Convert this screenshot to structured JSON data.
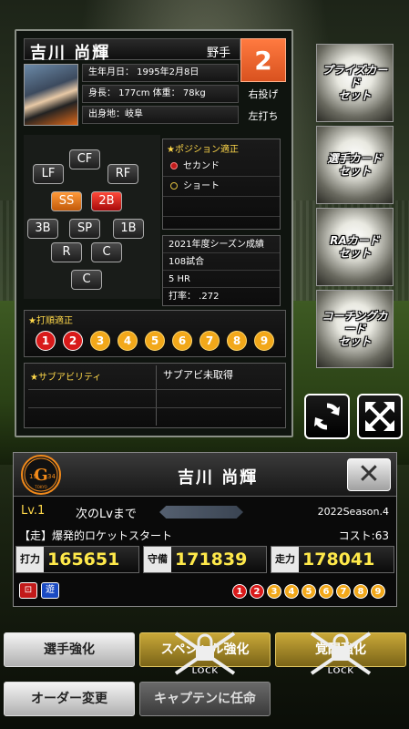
{
  "player": {
    "name": "吉川 尚輝",
    "type": "野手",
    "number": "2",
    "throws": "右投げ",
    "bats": "左打ち",
    "birthdate": "生年月日： 1995年2月8日",
    "body": "身長： 177cm 体重： 78kg",
    "birthplace": "出身地：岐阜"
  },
  "positions": {
    "LF": "LF",
    "CF": "CF",
    "RF": "RF",
    "SS": "SS",
    "2B": "2B",
    "3B": "3B",
    "SP": "SP",
    "1B": "1B",
    "R": "R",
    "C1": "C",
    "C2": "C"
  },
  "aptitude": {
    "title": "★ポジション適正",
    "opt1": "セカンド",
    "opt2": "ショート"
  },
  "season_stats": {
    "title": "2021年度シーズン成績",
    "games": "108試合",
    "hr": "5 HR",
    "avg": "打率： .272"
  },
  "batting_order": {
    "title": "★打順適正",
    "numbers": [
      "1",
      "2",
      "3",
      "4",
      "5",
      "6",
      "7",
      "8",
      "9"
    ],
    "active": [
      true,
      true,
      false,
      false,
      false,
      false,
      false,
      false,
      false
    ]
  },
  "sub_ability": {
    "title": "★サブアビリティ",
    "status": "サブアビ未取得"
  },
  "side_buttons": {
    "prize": "プライズカード\nセット",
    "player": "選手カード\nセット",
    "ra": "RAカード\nセット",
    "coaching": "コーチングカード\nセット"
  },
  "info_card": {
    "name": "吉川 尚輝",
    "logo_top": "G",
    "logo_year_left": "19",
    "logo_year_right": "34",
    "logo_sub": "TOKYO",
    "close": "✕",
    "level": "Lv.1",
    "next_level": "次のLvまで",
    "season": "2022Season.4",
    "skill": "【走】爆発的ロケットスタート",
    "cost": "コスト:63",
    "batting_label": "打力",
    "batting_value": "165651",
    "defense_label": "守備",
    "defense_value": "171839",
    "speed_label": "走力",
    "speed_value": "178041",
    "icon1": "⊡",
    "icon2": "遊",
    "order_numbers": [
      "1",
      "2",
      "3",
      "4",
      "5",
      "6",
      "7",
      "8",
      "9"
    ],
    "order_active": [
      true,
      true,
      false,
      false,
      false,
      false,
      false,
      false,
      false
    ]
  },
  "actions": {
    "enhance": "選手強化",
    "special": "スペシャル強化",
    "awaken": "覚醒強化",
    "lock": "LOCK",
    "order": "オーダー変更",
    "captain": "キャプテンに任命"
  },
  "colors": {
    "accent_orange": "#f2a81a",
    "active_red": "#d81a1a",
    "stat_yellow": "#ffe94a"
  }
}
